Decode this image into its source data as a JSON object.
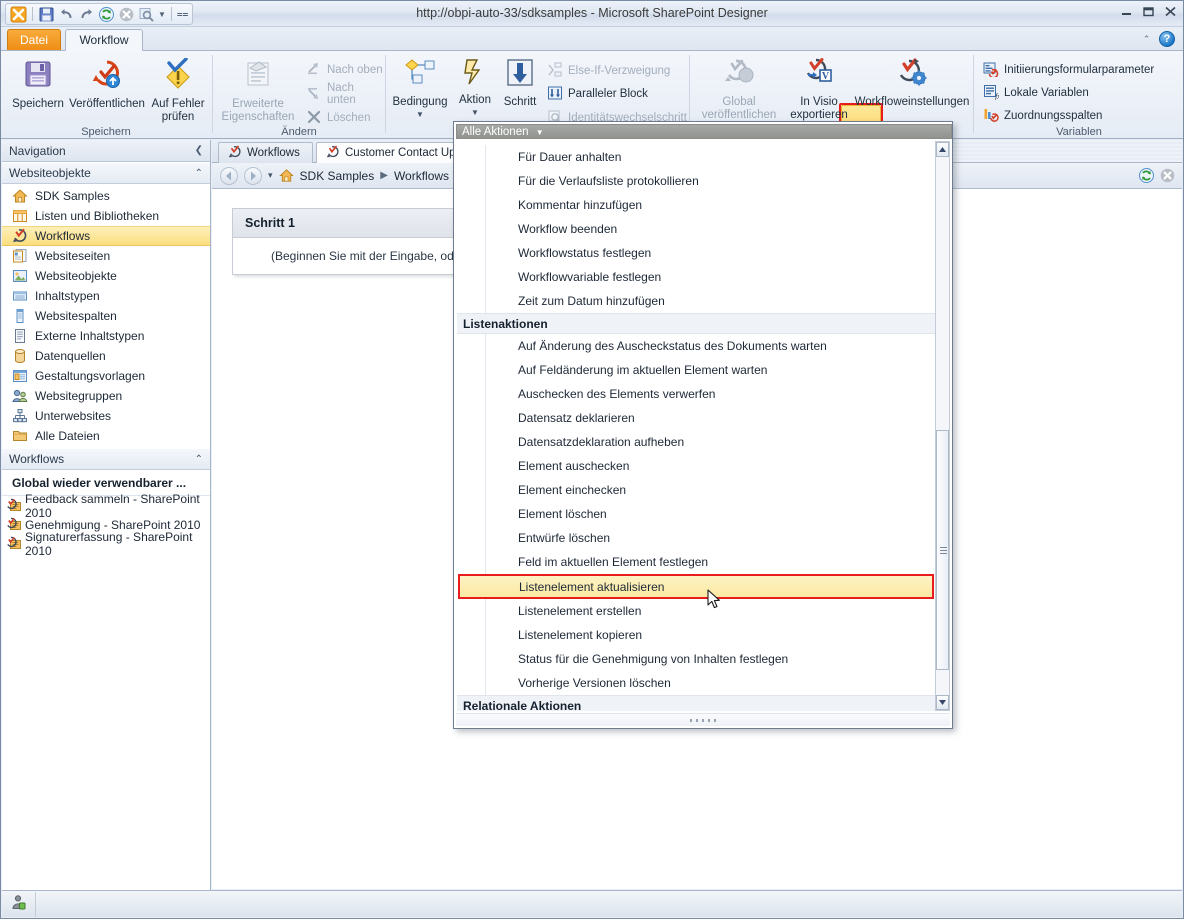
{
  "window": {
    "title": "http://obpi-auto-33/sdksamples - Microsoft SharePoint Designer",
    "minimize": "—",
    "maximize": "❐",
    "close": "✕"
  },
  "quick_access": {
    "items": [
      {
        "name": "app-logo-icon",
        "label": ""
      },
      {
        "name": "save-icon",
        "label": ""
      },
      {
        "name": "undo-icon",
        "label": ""
      },
      {
        "name": "redo-icon",
        "label": ""
      },
      {
        "name": "refresh-icon",
        "label": ""
      },
      {
        "name": "stop-icon",
        "label": ""
      },
      {
        "name": "preview-icon",
        "label": ""
      },
      {
        "name": "customize-qat-icon",
        "label": ""
      }
    ]
  },
  "ribbon": {
    "tabs": [
      {
        "label": "Datei",
        "active": false
      },
      {
        "label": "Workflow",
        "active": true
      }
    ],
    "help_label": "?",
    "groups": [
      {
        "label": "Speichern",
        "buttons": [
          {
            "label": "Speichern",
            "icon": "floppy-disk-icon",
            "disabled": false
          },
          {
            "label": "Veröffentlichen",
            "icon": "publish-icon",
            "disabled": false
          },
          {
            "label": "Auf Fehler prüfen",
            "icon": "check-errors-icon",
            "disabled": false
          }
        ]
      },
      {
        "label": "Ändern",
        "buttons": [
          {
            "label": "Erweiterte Eigenschaften",
            "icon": "advanced-properties-icon",
            "disabled": true
          }
        ],
        "small_buttons": [
          {
            "label": "Nach oben",
            "icon": "move-up-icon",
            "disabled": true
          },
          {
            "label": "Nach unten",
            "icon": "move-down-icon",
            "disabled": true
          },
          {
            "label": "Löschen",
            "icon": "delete-x-icon",
            "disabled": true
          }
        ]
      },
      {
        "label": "",
        "buttons": [
          {
            "label": "Bedingung",
            "icon": "condition-icon",
            "disabled": false,
            "dropdown": true
          },
          {
            "label": "Aktion",
            "icon": "action-lightning-icon",
            "disabled": false,
            "dropdown": true,
            "highlighted": true
          },
          {
            "label": "Schritt",
            "icon": "step-arrow-icon",
            "disabled": false
          }
        ],
        "small_buttons": [
          {
            "label": "Else-If-Verzweigung",
            "icon": "else-if-branch-icon",
            "disabled": true
          },
          {
            "label": "Paralleler Block",
            "icon": "parallel-block-icon",
            "disabled": false
          },
          {
            "label": "Identitätswechselschritt",
            "icon": "impersonation-step-icon",
            "disabled": true
          }
        ]
      },
      {
        "label": "",
        "buttons": [
          {
            "label": "Global veröffentlichen",
            "icon": "publish-globally-icon",
            "disabled": true
          },
          {
            "label": "In Visio exportieren",
            "icon": "export-visio-icon",
            "disabled": false
          },
          {
            "label": "Workfloweinstellungen",
            "icon": "workflow-settings-icon",
            "disabled": false
          }
        ]
      },
      {
        "label": "Variablen",
        "small_buttons": [
          {
            "label": "Initiierungsformularparameter",
            "icon": "init-form-params-icon",
            "disabled": false
          },
          {
            "label": "Lokale Variablen",
            "icon": "local-variables-icon",
            "disabled": false
          },
          {
            "label": "Zuordnungsspalten",
            "icon": "association-columns-icon",
            "disabled": false
          }
        ]
      }
    ]
  },
  "navigation": {
    "title": "Navigation",
    "collapse_glyph": "❮",
    "sections": [
      {
        "title": "Websiteobjekte",
        "chevron": "⌃",
        "items": [
          {
            "label": "SDK Samples",
            "icon": "home-icon",
            "selected": false
          },
          {
            "label": "Listen und Bibliotheken",
            "icon": "lists-libraries-icon",
            "selected": false
          },
          {
            "label": "Workflows",
            "icon": "workflows-icon",
            "selected": true
          },
          {
            "label": "Websiteseiten",
            "icon": "site-pages-icon",
            "selected": false
          },
          {
            "label": "Websiteobjekte",
            "icon": "site-assets-icon",
            "selected": false
          },
          {
            "label": "Inhaltstypen",
            "icon": "content-types-icon",
            "selected": false
          },
          {
            "label": "Websitespalten",
            "icon": "site-columns-icon",
            "selected": false
          },
          {
            "label": "Externe Inhaltstypen",
            "icon": "external-content-types-icon",
            "selected": false
          },
          {
            "label": "Datenquellen",
            "icon": "data-sources-icon",
            "selected": false
          },
          {
            "label": "Gestaltungsvorlagen",
            "icon": "master-pages-icon",
            "selected": false
          },
          {
            "label": "Websitegruppen",
            "icon": "site-groups-icon",
            "selected": false
          },
          {
            "label": "Unterwebsites",
            "icon": "subsites-icon",
            "selected": false
          },
          {
            "label": "Alle Dateien",
            "icon": "all-files-icon",
            "selected": false
          }
        ]
      },
      {
        "title": "Workflows",
        "chevron": "⌃",
        "group_header": "Global wieder verwendbarer ...",
        "items": [
          {
            "label": "Feedback sammeln - SharePoint 2010",
            "icon": "workflow-item-icon"
          },
          {
            "label": "Genehmigung - SharePoint 2010",
            "icon": "workflow-item-icon"
          },
          {
            "label": "Signaturerfassung - SharePoint 2010",
            "icon": "workflow-item-icon"
          }
        ]
      }
    ]
  },
  "document_tabs": {
    "tabs": [
      {
        "label": "Workflows",
        "icon": "workflows-icon",
        "active": false
      },
      {
        "label": "Customer Contact Updat",
        "icon": "workflows-icon",
        "active": true
      }
    ],
    "close_glyph": "✕"
  },
  "breadcrumb": {
    "back_glyph": "◀",
    "forward_glyph": "▶",
    "dropdown_glyph": "▾",
    "separator": "▶",
    "items": [
      {
        "label": "SDK Samples",
        "icon": "home-icon"
      },
      {
        "label": "Workflows",
        "icon": ""
      }
    ],
    "refresh_glyph": "↻",
    "stop_glyph": "✕"
  },
  "canvas": {
    "step_title": "Schritt 1",
    "step_hint": "(Beginnen Sie mit der Eingabe, oder"
  },
  "gallery": {
    "header_label": "Alle Aktionen",
    "header_chevron": "▼",
    "scroll_up_glyph": "▲",
    "scroll_down_glyph": "▼",
    "sections": [
      {
        "title": "",
        "items": [
          "Für Dauer anhalten",
          "Für die Verlaufsliste protokollieren",
          "Kommentar hinzufügen",
          "Workflow beenden",
          "Workflowstatus festlegen",
          "Workflowvariable festlegen",
          "Zeit zum Datum hinzufügen"
        ]
      },
      {
        "title": "Listenaktionen",
        "items": [
          "Auf Änderung des Auscheckstatus des Dokuments warten",
          "Auf Feldänderung im aktuellen Element warten",
          "Auschecken des Elements verwerfen",
          "Datensatz deklarieren",
          "Datensatzdeklaration aufheben",
          "Element auschecken",
          "Element einchecken",
          "Element löschen",
          "Entwürfe löschen",
          "Feld im aktuellen Element festlegen",
          "Listenelement aktualisieren",
          "Listenelement erstellen",
          "Listenelement kopieren",
          "Status für die Genehmigung von Inhalten festlegen",
          "Vorherige Versionen löschen"
        ]
      },
      {
        "title": "Relationale Aktionen",
        "items": []
      }
    ],
    "highlighted_item": "Listenelement aktualisieren"
  },
  "status_bar": {
    "user_icon": "user-account-icon"
  },
  "colors": {
    "accent_orange": "#ef8e15",
    "highlight_red": "#e81c1c",
    "highlight_yellow": "#fbe9a2",
    "selection_yellow": "#fbdf7e",
    "chrome_blue": "#dfe6f1"
  }
}
